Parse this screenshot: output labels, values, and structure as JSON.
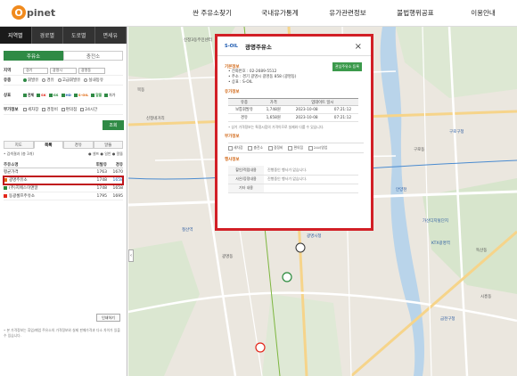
{
  "header": {
    "logo_letter": "O",
    "logo_text": "pinet",
    "nav": [
      "싼 주유소찾기",
      "국내유가통계",
      "유가관련정보",
      "불법행위공표",
      "이용안내"
    ]
  },
  "left": {
    "tabs": [
      "지역별",
      "경로별",
      "도로별",
      "면세유"
    ],
    "subtabs": [
      "주유소",
      "충전소"
    ],
    "form": {
      "region_label": "지역",
      "region_values": [
        "경기",
        "광명시",
        "광명동"
      ],
      "fuel_label": "유종",
      "fuel_options": [
        "휘발유",
        "경유",
        "고급휘발유",
        "실내등유"
      ],
      "brand_label": "상표",
      "brand_all": "전체",
      "brands": [
        "SK",
        "GS",
        "HD",
        "S-OIL",
        "알뜰",
        "자가"
      ],
      "service_label": "부가정보",
      "service_options": [
        "세차장",
        "경정비",
        "편의점",
        "24시간"
      ],
      "search_button": "조회"
    },
    "result_tabs": [
      "지도",
      "목록",
      "경유",
      "알뜰"
    ],
    "result_info": "• 검색결과 (총 3개)",
    "result_legend": "● 셀프  ● 일반  ● 알뜰",
    "result_header": [
      "주유소명",
      "휘발유",
      "경유"
    ],
    "avg_label": "평균가격",
    "avg_values": [
      "1763",
      "1670"
    ],
    "rows": [
      {
        "name": "광명주유소",
        "gas": "1748",
        "diesel": "1658",
        "brand": "S-OIL"
      },
      {
        "name": "(주)지에스이앤알",
        "gas": "1748",
        "diesel": "1658",
        "brand": "GS"
      },
      {
        "name": "동광셀프주유소",
        "gas": "1795",
        "diesel": "1695",
        "brand": "SK"
      }
    ],
    "print_button": "인쇄하기",
    "foot_note": "• 본 가격정보는 휴업/폐업 주유소의 가격정보와 실제 판매가격과 다소 차이가 있을 수 있습니다."
  },
  "popup": {
    "brand": "S-OIL",
    "title": "광명주유소",
    "fav_button": "관심주유소 등록",
    "basic_label": "기본정보",
    "phone": "• 전화번호 : 02-2689-5512",
    "address": "• 주소 : 경기 광명시 광명동 858 (광명동)",
    "brand_line": "• 상표 : S-OIL",
    "price_label": "유가정보",
    "price_header": [
      "유종",
      "가격",
      "업데이트 일시"
    ],
    "price_rows": [
      {
        "fuel": "보통휘발유",
        "price": "1,748원",
        "date": "2023-10-08",
        "time": "07:21:12"
      },
      {
        "fuel": "경유",
        "price": "1,658원",
        "date": "2023-10-08",
        "time": "07:21:12"
      }
    ],
    "price_note": "• 상기 가격정보는 특정시점의 가격이므로 실제와 다를 수 있습니다.",
    "service_label": "부가정보",
    "services": [
      "세차장",
      "충전소",
      "경정비",
      "편의점",
      "24시영업"
    ],
    "ad_label": "행사정보",
    "ad_rows": [
      {
        "k": "할인/적립내용",
        "v": "진행중인 행사가 없습니다."
      },
      {
        "k": "사은/증정내용",
        "v": "진행중인 행사가 없습니다."
      },
      {
        "k": "기타 내용",
        "v": ""
      }
    ]
  },
  "map_labels": {
    "l1": "신정3동주민센터",
    "l2": "목동",
    "l3": "신정네거리",
    "l4": "구로구청",
    "l5": "구로동",
    "l6": "광명시청",
    "l7": "광명사거리",
    "l8": "철산역",
    "l9": "광명동",
    "l10": "가산디지털단지",
    "l11": "독산동",
    "l12": "안양천",
    "l13": "KTX광명역",
    "l14": "시흥동",
    "l15": "금천구청"
  },
  "colors": {
    "accent": "#2f8a45",
    "highlight": "#d21f26",
    "logo": "#f08a1d"
  }
}
